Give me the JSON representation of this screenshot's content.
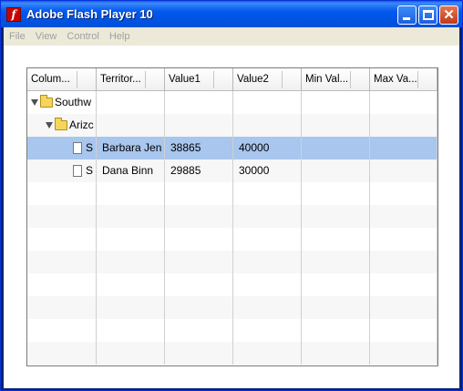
{
  "window": {
    "title": "Adobe Flash Player 10",
    "icon": "flash-icon"
  },
  "menu": [
    "File",
    "View",
    "Control",
    "Help"
  ],
  "grid": {
    "headers": [
      "Colum...",
      "Territor...",
      "Value1",
      "Value2",
      "Min Val...",
      "Max Va..."
    ],
    "rows": [
      {
        "level": 0,
        "type": "folder",
        "expanded": true,
        "col0": "Southw",
        "cells": [
          "",
          "",
          "",
          "",
          ""
        ]
      },
      {
        "level": 1,
        "type": "folder",
        "expanded": true,
        "col0": "Arizc",
        "cells": [
          "",
          "",
          "",
          "",
          ""
        ]
      },
      {
        "level": 2,
        "type": "leaf",
        "selected": true,
        "col0": "S",
        "cells": [
          "Barbara Jen",
          "38865",
          "40000",
          "",
          ""
        ]
      },
      {
        "level": 2,
        "type": "leaf",
        "col0": "S",
        "cells": [
          "Dana Binn",
          "29885",
          "30000",
          "",
          ""
        ]
      }
    ],
    "empty_rows": 8
  }
}
